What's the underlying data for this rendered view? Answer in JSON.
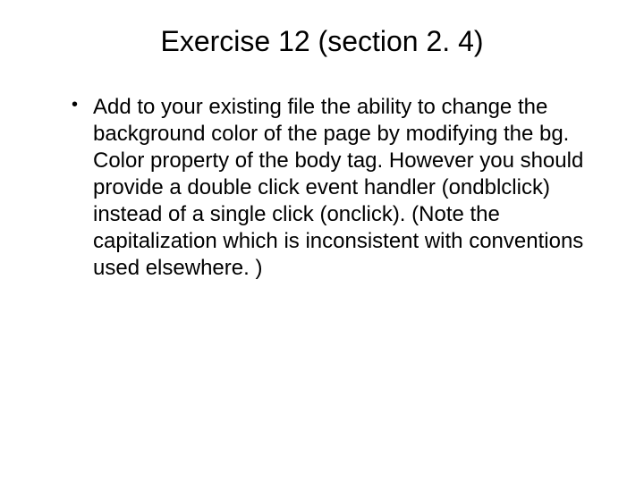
{
  "title": "Exercise 12 (section 2. 4)",
  "bullets": [
    "Add to your existing file the ability to change the background color of the page by modifying the bg. Color property of the body tag. However you should provide a double click event handler (ondblclick) instead of a single click (onclick). (Note the capitalization which is inconsistent with conventions used elsewhere. )"
  ]
}
